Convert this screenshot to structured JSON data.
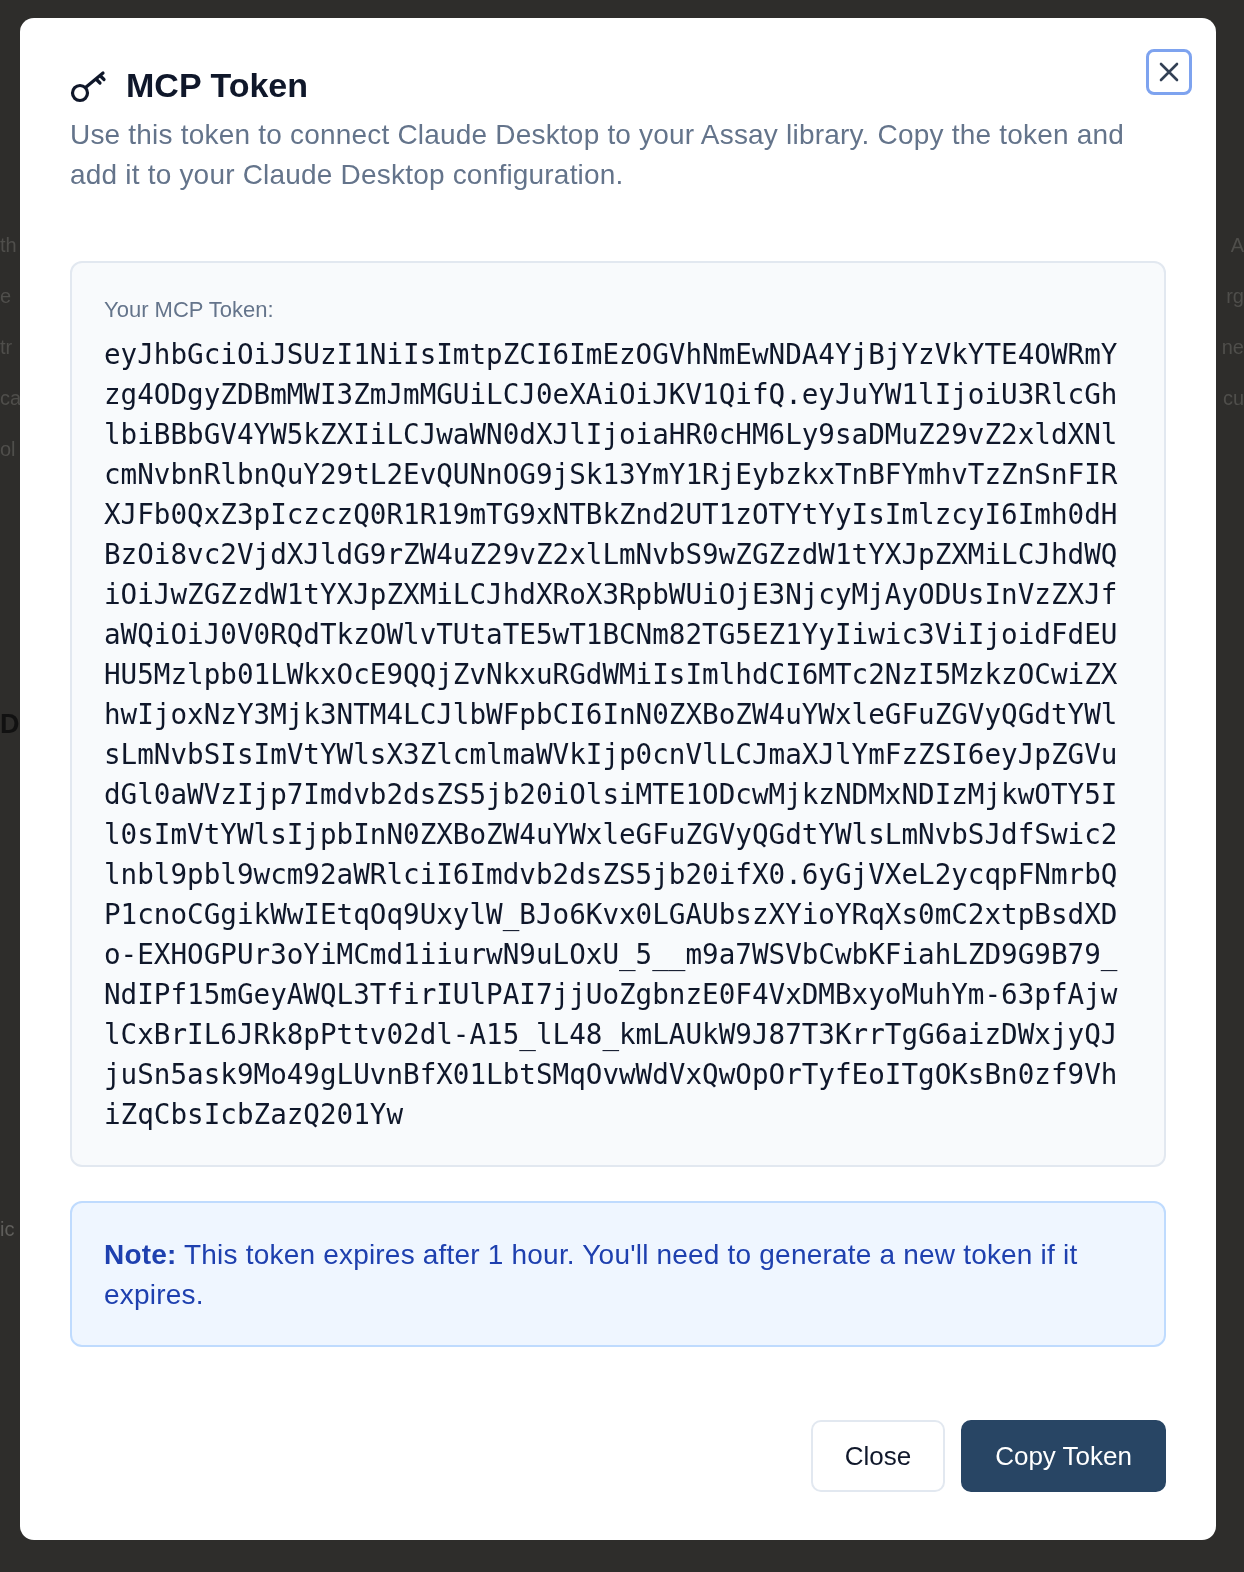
{
  "background": {
    "left_lines": [
      "th",
      "e",
      "tr",
      "ca",
      "ol"
    ],
    "left_heading": "D",
    "left_footer": "ic",
    "right_lines": [
      "A",
      "rg",
      "ne",
      "cu"
    ]
  },
  "dialog": {
    "title": "MCP Token",
    "description": "Use this token to connect Claude Desktop to your Assay library. Copy the token and add it to your Claude Desktop configuration.",
    "close_icon_focused": true,
    "token_label": "Your MCP Token:",
    "token": "eyJhbGciOiJSUzI1NiIsImtpZCI6ImEzOGVhNmEwNDA4YjBjYzVkYTE4OWRmYzg4ODgyZDBmMWI3ZmJmMGUiLCJ0eXAiOiJKV1QifQ.eyJuYW1lIjoiU3RlcGhlbiBBbGV4YW5kZXIiLCJwaWN0dXJlIjoiaHR0cHM6Ly9saDMuZ29vZ2xldXNlcmNvbnRlbnQuY29tL2EvQUNnOG9jSk13YmY1RjEybzkxTnBFYmhvTzZnSnFIRXJFb0QxZ3pIczczQ0R1R19mTG9xNTBkZnd2UT1zOTYtYyIsImlzcyI6Imh0dHBzOi8vc2VjdXJldG9rZW4uZ29vZ2xlLmNvbS9wZGZzdW1tYXJpZXMiLCJhdWQiOiJwZGZzdW1tYXJpZXMiLCJhdXRoX3RpbWUiOjE3NjcyMjAyODUsInVzZXJfaWQiOiJ0V0RQdTkzOWlvTUtaTE5wT1BCNm82TG5EZ1YyIiwic3ViIjoidFdEUHU5Mzlpb01LWkxOcE9QQjZvNkxuRGdWMiIsImlhdCI6MTc2NzI5MzkzOCwiZXhwIjoxNzY3Mjk3NTM4LCJlbWFpbCI6InN0ZXBoZW4uYWxleGFuZGVyQGdtYWlsLmNvbSIsImVtYWlsX3ZlcmlmaWVkIjp0cnVlLCJmaXJlYmFzZSI6eyJpZGVudGl0aWVzIjp7Imdvb2dsZS5jb20iOlsiMTE1ODcwMjkzNDMxNDIzMjkwOTY5Il0sImVtYWlsIjpbInN0ZXBoZW4uYWxleGFuZGVyQGdtYWlsLmNvbSJdfSwic2lnbl9pbl9wcm92aWRlciI6Imdvb2dsZS5jb20ifX0.6yGjVXeL2ycqpFNmrbQP1cnoCGgikWwIEtqOq9UxylW_BJo6Kvx0LGAUbszXYioYRqXs0mC2xtpBsdXDo-EXHOGPUr3oYiMCmd1iiurwN9uLOxU_5__m9a7WSVbCwbKFiahLZD9G9B79_NdIPf15mGeyAWQL3TfirIUlPAI7jjUoZgbnzE0F4VxDMBxyoMuhYm-63pfAjwlCxBrIL6JRk8pPttv02dl-A15_lL48_kmLAUkW9J87T3KrrTgG6aizDWxjyQJjuSn5ask9Mo49gLUvnBfX01LbtSMqOvwWdVxQwOpOrTyfEoITgOKsBn0zf9VhiZqCbsIcbZazQ201Yw",
    "note": "**Note:** This token expires after 1 hour. You'll need to generate a new token if it expires.",
    "buttons": [
      {
        "kind": "secondary",
        "label": "Close"
      },
      {
        "kind": "primary",
        "label": "Copy Token"
      }
    ]
  }
}
